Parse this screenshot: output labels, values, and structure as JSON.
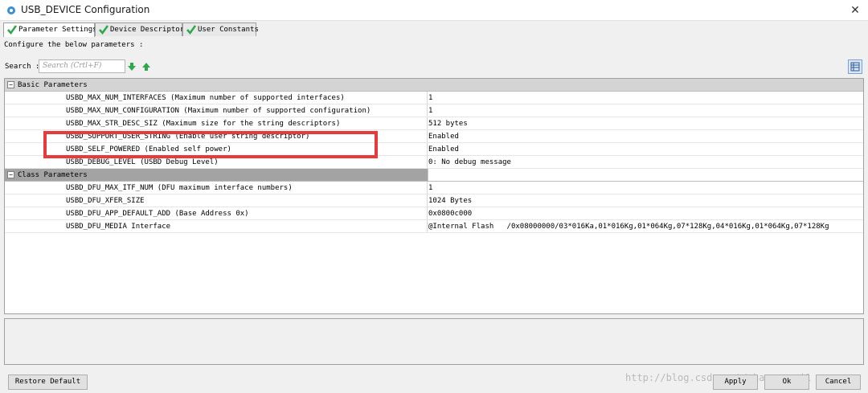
{
  "window": {
    "title": "USB_DEVICE Configuration",
    "close_glyph": "✕"
  },
  "tabs": [
    {
      "label": "Parameter Settings",
      "icon": "check-icon",
      "active": true
    },
    {
      "label": "Device Descriptor",
      "icon": "check-icon",
      "active": false
    },
    {
      "label": "User Constants",
      "icon": "check-icon",
      "active": false
    }
  ],
  "subtitle": "Configure the below parameters :",
  "search": {
    "label": "Search",
    "placeholder": "Search (Crtl+F)"
  },
  "groups": {
    "basic": {
      "label": "Basic Parameters",
      "toggle": "−",
      "rows": [
        {
          "name": "USBD_MAX_NUM_INTERFACES (Maximum number of supported interfaces)",
          "value": "1"
        },
        {
          "name": "USBD_MAX_NUM_CONFIGURATION (Maximum number of supported configuration)",
          "value": "1"
        },
        {
          "name": "USBD_MAX_STR_DESC_SIZ (Maximum size for the string descriptors)",
          "value": "512 bytes"
        },
        {
          "name": "USBD_SUPPORT_USER_STRING (Enable user string descriptor)",
          "value": "Enabled"
        },
        {
          "name": "USBD_SELF_POWERED (Enabled self power)",
          "value": "Enabled"
        },
        {
          "name": "USBD_DEBUG_LEVEL (USBD Debug Level)",
          "value": "0: No debug message"
        }
      ]
    },
    "class": {
      "label": "Class Parameters",
      "toggle": "−",
      "rows": [
        {
          "name": "USBD_DFU_MAX_ITF_NUM (DFU maximum interface numbers)",
          "value": "1"
        },
        {
          "name": "USBD_DFU_XFER_SIZE",
          "value": "1024 Bytes"
        },
        {
          "name": "USBD_DFU_APP_DEFAULT_ADD (Base Address 0x)",
          "value": "0x0800c000"
        },
        {
          "name": "USBD_DFU_MEDIA Interface",
          "value": "@Internal Flash   /0x08000000/03*016Ka,01*016Kg,01*064Kg,07*128Kg,04*016Kg,01*064Kg,07*128Kg"
        }
      ]
    }
  },
  "buttons": {
    "restore": "Restore Default",
    "apply": "Apply",
    "ok": "Ok",
    "cancel": "Cancel"
  },
  "watermark": "http://blog.csdn.net/zhangyongi1",
  "colors": {
    "highlight": "#e83a3a",
    "accent": "#2ea84a"
  }
}
